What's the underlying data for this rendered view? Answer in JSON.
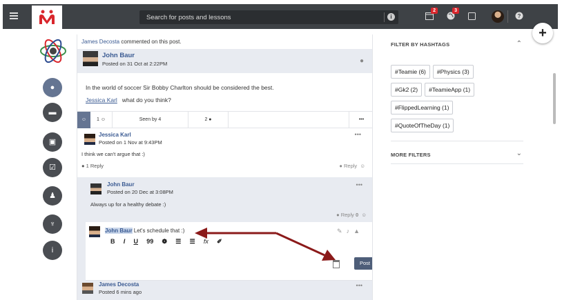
{
  "topbar": {
    "search_placeholder": "Search for posts and lessons",
    "calendar_badge": "2",
    "globe_badge": "3"
  },
  "feed": {
    "notice_name": "James Decosta",
    "notice_text": " commented on this post.",
    "post": {
      "author": "John Baur",
      "date": "Posted on 31 Oct at 2:22PM",
      "body": "In the world of soccer Sir Bobby Charlton should be considered the best.",
      "mention": "Jessica Karl",
      "body2": "what do you think?"
    },
    "stats": {
      "likes": "1",
      "seen": "Seen by 4",
      "comments": "2",
      "more": "•••"
    },
    "comment1": {
      "author": "Jessica Karl",
      "date": "Posted on 1 Nov at 9:43PM",
      "text": "I think we can't argue that :)",
      "replies": "1 Reply",
      "reply_label": "Reply"
    },
    "comment2": {
      "author": "John Baur",
      "date": "Posted on 20 Dec at 3:08PM",
      "text": "Always up for a healthy debate :)",
      "reply_label": "Reply",
      "reply_count": "0"
    },
    "composer": {
      "mention": "John Baur",
      "text": "Let's schedule that :)",
      "post_label": "Post",
      "toolbar": [
        "B",
        "I",
        "U",
        "99",
        "❁",
        "☰",
        "☰",
        "fx",
        "✐"
      ]
    },
    "comment3": {
      "author": "James Decosta",
      "date": "Posted 6 mins ago"
    }
  },
  "filters": {
    "hashtags_title": "FILTER BY HASHTAGS",
    "tags": [
      "#Teamie (6)",
      "#Physics (3)",
      "#Gk2 (2)",
      "#TeamieApp (1)",
      "#FlippedLearning (1)",
      "#QuoteOfTheDay (1)"
    ],
    "more_title": "MORE FILTERS"
  },
  "colors": {
    "topbar": "#3e4246",
    "accent": "#657592",
    "badge": "#d9262c",
    "arrow": "#8b1a1a",
    "link": "#3a5a92"
  }
}
